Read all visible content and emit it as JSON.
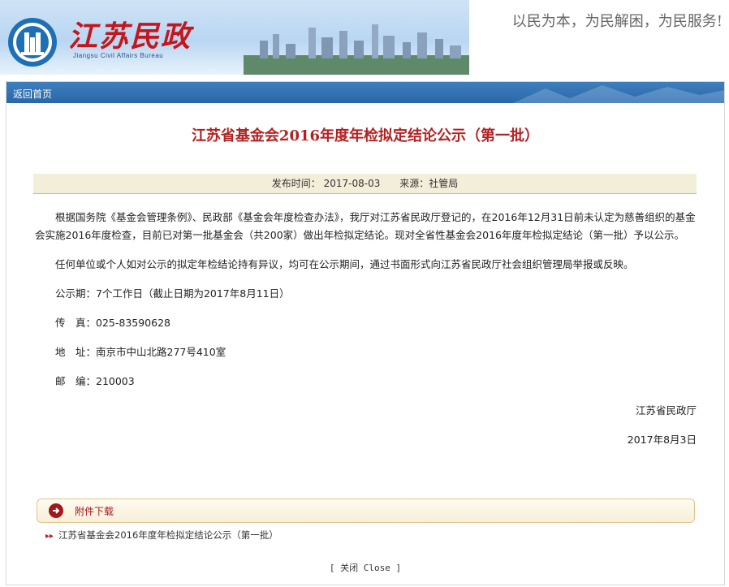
{
  "header": {
    "brand_cn": "江苏民政",
    "brand_en": "Jiangsu Civil Affairs Bureau",
    "motto": "以民为本，为民解困，为民服务!"
  },
  "nav": {
    "back_label": "返回首页"
  },
  "article": {
    "title": "江苏省基金会2016年度年检拟定结论公示（第一批）",
    "publish_label": "发布时间：",
    "publish_date": "2017-08-03",
    "source_label": "来源：",
    "source": "社管局",
    "paragraph1": "根据国务院《基金会管理条例》、民政部《基金会年度检查办法》，我厅对江苏省民政厅登记的，在2016年12月31日前未认定为慈善组织的基金会实施2016年度检查，目前已对第一批基金会（共200家）做出年检拟定结论。现对全省性基金会2016年度年检拟定结论（第一批）予以公示。",
    "paragraph2": "任何单位或个人如对公示的拟定年检结论持有异议，均可在公示期间，通过书面形式向江苏省民政厅社会组织管理局举报或反映。",
    "period": "公示期：7个工作日（截止日期为2017年8月11日）",
    "fax": "传　真：025-83590628",
    "address": "地　址：南京市中山北路277号410室",
    "postcode": "邮　编：210003",
    "signature": "江苏省民政厅",
    "sign_date": "2017年8月3日"
  },
  "attachments": {
    "label": "附件下载",
    "files": [
      "江苏省基金会2016年度年检拟定结论公示（第一批）"
    ]
  },
  "footer": {
    "close_label": "[ 关闭 Close ]"
  },
  "colors": {
    "title": "#b22222",
    "topbar": "#2a67a8",
    "meta_bg": "#f3eeda"
  }
}
